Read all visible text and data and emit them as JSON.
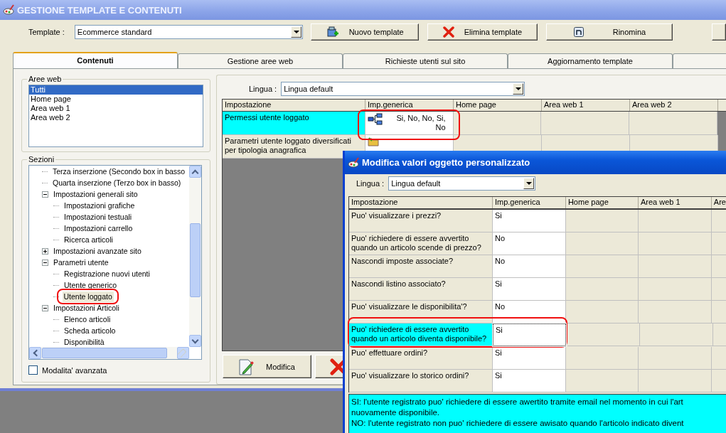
{
  "main_window": {
    "title": "GESTIONE TEMPLATE E CONTENUTI",
    "template": {
      "label": "Template :",
      "value": "Ecommerce standard"
    },
    "toolbar_buttons": [
      {
        "label": "Nuovo template",
        "kind": "new"
      },
      {
        "label": "Elimina template",
        "kind": "delete"
      },
      {
        "label": "Rinomina",
        "kind": "rename"
      },
      {
        "kind": "other"
      }
    ],
    "tabs": [
      {
        "label": "Contenuti",
        "selected": true
      },
      {
        "label": "Gestione aree web",
        "selected": false
      },
      {
        "label": "Richieste utenti sul sito",
        "selected": false
      },
      {
        "label": "Aggiornamento template",
        "selected": false
      },
      {
        "selected": false
      }
    ],
    "aree_web": {
      "title": "Aree web",
      "items": [
        {
          "label": "Tutti",
          "selected": true
        },
        {
          "label": "Home page",
          "selected": false
        },
        {
          "label": "Area web 1",
          "selected": false
        },
        {
          "label": "Area web 2",
          "selected": false
        }
      ]
    },
    "sezioni": {
      "title": "Sezioni",
      "items": [
        {
          "label": "Terza inserzione (Secondo box in basso",
          "selected": false,
          "annotated": false
        },
        {
          "label": "Quarta inserzione (Terzo box in basso)",
          "selected": false,
          "annotated": false
        },
        {
          "label": "Impostazioni generali sito",
          "selected": false,
          "annotated": false,
          "expanded": true,
          "children": [
            {
              "label": "Impostazioni grafiche",
              "selected": false,
              "annotated": false
            },
            {
              "label": "Impostazioni testuali",
              "selected": false,
              "annotated": false
            },
            {
              "label": "Impostazioni carrello",
              "selected": false,
              "annotated": false
            },
            {
              "label": "Ricerca articoli",
              "selected": false,
              "annotated": false
            }
          ]
        },
        {
          "label": "Impostazioni avanzate sito",
          "selected": false,
          "annotated": false,
          "expanded": false
        },
        {
          "label": "Parametri utente",
          "selected": false,
          "annotated": false,
          "expanded": true,
          "children": [
            {
              "label": "Registrazione nuovi utenti",
              "selected": false,
              "annotated": false
            },
            {
              "label": "Utente generico",
              "selected": false,
              "annotated": false
            },
            {
              "label": "Utente loggato",
              "selected": true,
              "annotated": true
            }
          ]
        },
        {
          "label": "Impostazioni Articoli",
          "selected": false,
          "annotated": false,
          "expanded": true,
          "children": [
            {
              "label": "Elenco articoli",
              "selected": false,
              "annotated": false
            },
            {
              "label": "Scheda articolo",
              "selected": false,
              "annotated": false
            },
            {
              "label": "Disponibilità",
              "selected": false,
              "annotated": false
            }
          ]
        }
      ]
    },
    "advanced_mode": {
      "label": "Modalita' avanzata",
      "checked": false
    },
    "lingua": {
      "label": "Lingua :",
      "value": "Lingua default"
    },
    "grid": {
      "columns": [
        "Impostazione",
        "Imp.generica",
        "Home page",
        "Area web 1",
        "Area web 2"
      ],
      "rows": [
        {
          "setting": "Permessi utente loggato",
          "selected": true,
          "annotated": true,
          "generic": {
            "kind": "list",
            "text": "Si, No, No, Si, No"
          }
        },
        {
          "setting": "Parametri utente loggato diversificati per tipologia anagrafica",
          "selected": false,
          "annotated": false,
          "generic": {
            "kind": "folder"
          }
        }
      ]
    },
    "buttons": [
      {
        "label": "Modifica",
        "kind": "edit"
      },
      {
        "kind": "delete"
      }
    ]
  },
  "dialog": {
    "title": "Modifica valori oggetto personalizzato",
    "lingua": {
      "label": "Lingua :",
      "value": "Lingua default"
    },
    "columns": [
      "Impostazione",
      "Imp.generica",
      "Home page",
      "Area web 1",
      "Are"
    ],
    "rows": [
      {
        "setting": "Puo' visualizzare i prezzi?",
        "value": "Si",
        "selected": false,
        "annotated": false
      },
      {
        "setting": "Puo' richiedere di essere avvertito quando un articolo scende di prezzo?",
        "value": "No",
        "selected": false,
        "annotated": false
      },
      {
        "setting": "Nascondi imposte associate?",
        "value": "No",
        "selected": false,
        "annotated": false
      },
      {
        "setting": "Nascondi listino associato?",
        "value": "Si",
        "selected": false,
        "annotated": false
      },
      {
        "setting": "Puo' visualizzare le disponibilita'?",
        "value": "No",
        "selected": false,
        "annotated": false
      },
      {
        "setting": "Puo' richiedere di essere avvertito quando un articolo diventa disponibile?",
        "value": "Si",
        "selected": true,
        "annotated": true
      },
      {
        "setting": "Puo' effettuare ordini?",
        "value": "Si",
        "selected": false,
        "annotated": false
      },
      {
        "setting": "Puo' visualizzare lo storico ordini?",
        "value": "Si",
        "selected": false,
        "annotated": false
      }
    ],
    "help_lines": [
      "SI: l'utente registrato puo' richiedere di essere awertito tramite email nel momento in cui l'art",
      "nuovamente disponibile.",
      "NO: l'utente registrato non puo' richiedere di essere awisato quando l'articolo indicato divent"
    ]
  }
}
